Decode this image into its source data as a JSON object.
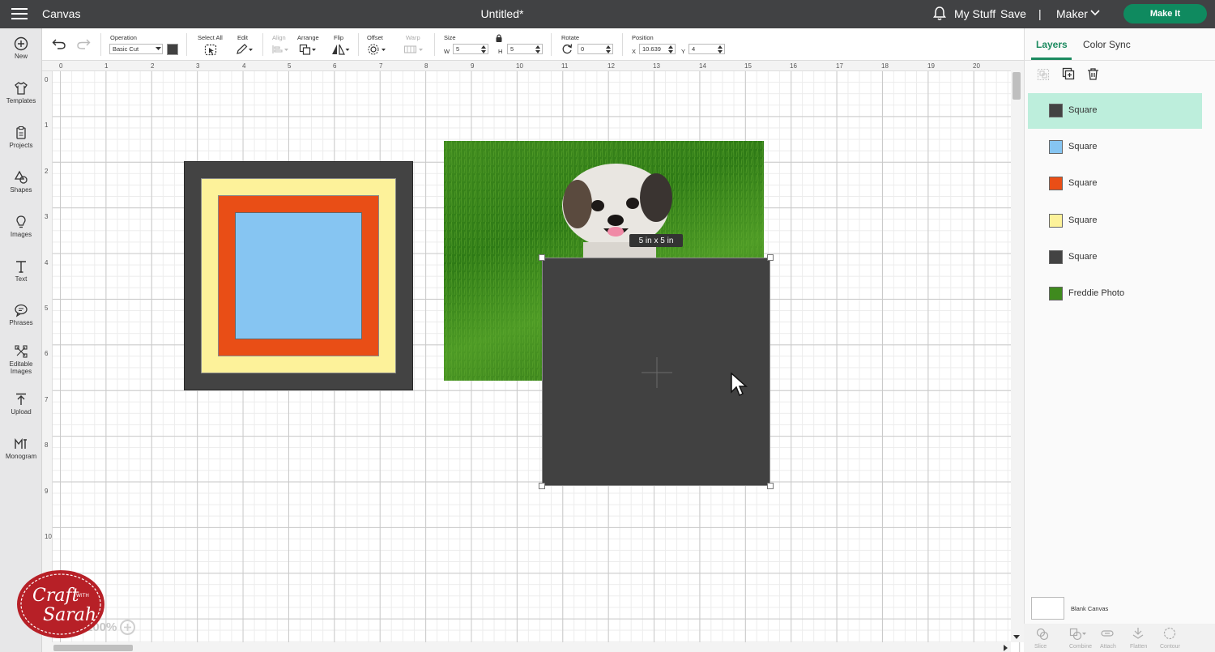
{
  "topbar": {
    "app_title": "Canvas",
    "doc_title": "Untitled*",
    "my_stuff": "My Stuff",
    "save": "Save",
    "separator": "|",
    "machine": "Maker",
    "make_it": "Make It",
    "accent_color": "#0f8a5f"
  },
  "sidebar": {
    "items": [
      {
        "label": "New",
        "icon": "plus-circle-icon"
      },
      {
        "label": "Templates",
        "icon": "shirt-icon"
      },
      {
        "label": "Projects",
        "icon": "clipboard-icon"
      },
      {
        "label": "Shapes",
        "icon": "shapes-icon"
      },
      {
        "label": "Images",
        "icon": "lightbulb-icon"
      },
      {
        "label": "Text",
        "icon": "text-icon"
      },
      {
        "label": "Phrases",
        "icon": "speech-bubble-icon"
      },
      {
        "label": "Editable Images",
        "line1": "Editable",
        "line2": "Images",
        "icon": "editable-images-icon"
      },
      {
        "label": "Upload",
        "icon": "upload-icon"
      },
      {
        "label": "Monogram",
        "icon": "monogram-icon"
      }
    ]
  },
  "toolbar": {
    "operation_label": "Operation",
    "operation_value": "Basic Cut",
    "select_all_label": "Select All",
    "edit_label": "Edit",
    "align_label": "Align",
    "arrange_label": "Arrange",
    "flip_label": "Flip",
    "offset_label": "Offset",
    "warp_label": "Warp",
    "size_label": "Size",
    "w_label": "W",
    "w_value": "5",
    "h_label": "H",
    "h_value": "5",
    "rotate_label": "Rotate",
    "rotate_value": "0",
    "position_label": "Position",
    "x_label": "X",
    "x_value": "10.639",
    "y_label": "Y",
    "y_value": "4"
  },
  "rulers": {
    "top": [
      "0",
      "1",
      "2",
      "3",
      "4",
      "5",
      "6",
      "7",
      "8",
      "9",
      "10",
      "11",
      "12",
      "13",
      "14",
      "15",
      "16",
      "17",
      "18",
      "19",
      "20"
    ],
    "left": [
      "0",
      "1",
      "2",
      "3",
      "4",
      "5",
      "6",
      "7",
      "8",
      "9",
      "10"
    ]
  },
  "canvas": {
    "size_tooltip": "5  in x 5  in",
    "zoom_level": "100%",
    "colors": {
      "dark": "#434343",
      "yellow": "#fdf29a",
      "orange": "#e94e16",
      "blue": "#86c5f2"
    }
  },
  "logo": {
    "line1": "Craft",
    "with": "WITH",
    "line2": "Sarah"
  },
  "right_panel": {
    "tabs": [
      "Layers",
      "Color Sync"
    ],
    "layers": [
      {
        "name": "Square",
        "color": "#434343",
        "selected": true
      },
      {
        "name": "Square",
        "color": "#86c5f2",
        "selected": false
      },
      {
        "name": "Square",
        "color": "#e94e16",
        "selected": false
      },
      {
        "name": "Square",
        "color": "#fdf29a",
        "selected": false
      },
      {
        "name": "Square",
        "color": "#434343",
        "selected": false
      },
      {
        "name": "Freddie Photo",
        "color": "#3f8a1e",
        "selected": false
      }
    ],
    "blank_canvas": "Blank Canvas",
    "bottom_tools": [
      "Slice",
      "Combine",
      "Attach",
      "Flatten",
      "Contour"
    ]
  }
}
